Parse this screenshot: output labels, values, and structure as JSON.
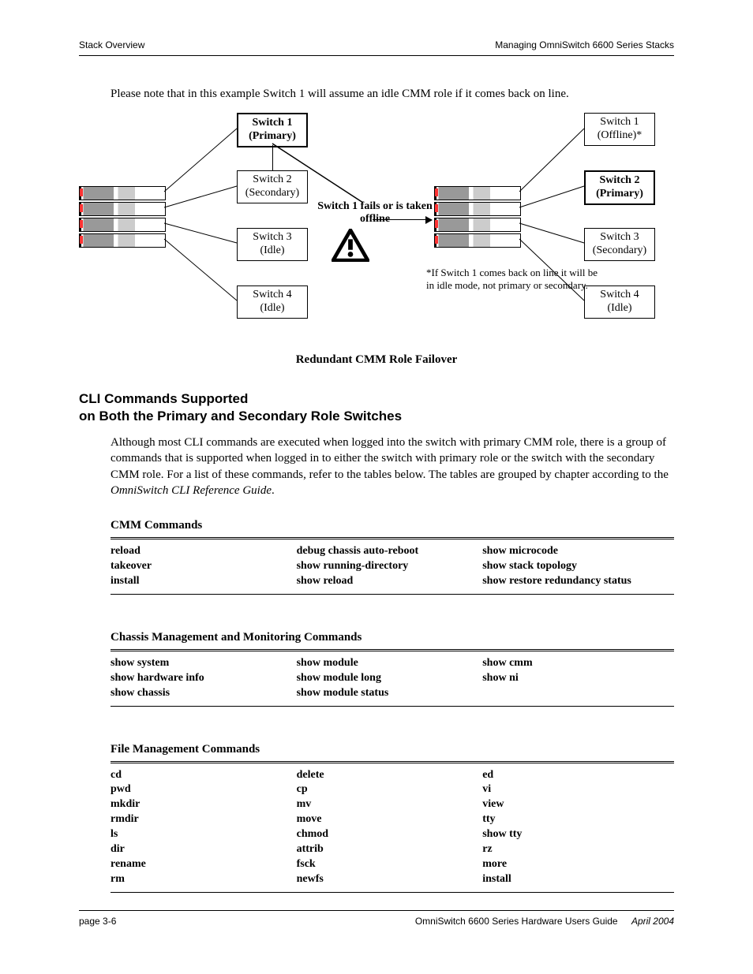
{
  "header": {
    "left": "Stack Overview",
    "right": "Managing OmniSwitch 6600 Series Stacks"
  },
  "intro": "Please note that in this example Switch 1 will assume an idle CMM role if it comes back on line.",
  "diagram": {
    "left": {
      "s1": {
        "l1": "Switch 1",
        "l2": "(Primary)"
      },
      "s2": {
        "l1": "Switch 2",
        "l2": "(Secondary)"
      },
      "s3": {
        "l1": "Switch 3",
        "l2": "(Idle)"
      },
      "s4": {
        "l1": "Switch 4",
        "l2": "(Idle)"
      }
    },
    "right": {
      "s1": {
        "l1": "Switch 1",
        "l2": "(Offline)*"
      },
      "s2": {
        "l1": "Switch 2",
        "l2": "(Primary)"
      },
      "s3": {
        "l1": "Switch 3",
        "l2": "(Secondary)"
      },
      "s4": {
        "l1": "Switch 4",
        "l2": "(Idle)"
      }
    },
    "center": "Switch 1 fails or is taken offline",
    "footnote": "*If Switch 1 comes back on line it will be in idle mode, not primary or secondary.",
    "caption": "Redundant CMM Role Failover"
  },
  "section_heading": {
    "l1": "CLI Commands Supported",
    "l2": "on Both the Primary and Secondary Role Switches"
  },
  "para": {
    "t1": "Although most CLI commands are executed when logged into the switch with primary CMM role, there is a group of commands that is supported when logged in to either the switch with primary role or the switch with the secondary CMM role. For a list of these commands, refer to the tables below. The tables are grouped by chapter according to the ",
    "em": "OmniSwitch CLI Reference Guide",
    "t2": "."
  },
  "tables": {
    "cmm": {
      "title": "CMM Commands",
      "c1": [
        "reload",
        "takeover",
        "install"
      ],
      "c2": [
        "debug chassis auto-reboot",
        "show running-directory",
        "show reload"
      ],
      "c3": [
        "show microcode",
        "show stack topology",
        "show restore redundancy status"
      ]
    },
    "chassis": {
      "title": "Chassis Management and Monitoring Commands",
      "c1": [
        "show system",
        "show hardware info",
        "show chassis"
      ],
      "c2": [
        "show module",
        "show module long",
        "show module status"
      ],
      "c3": [
        "show cmm",
        "show ni"
      ]
    },
    "file": {
      "title": "File Management Commands",
      "c1": [
        "cd",
        "pwd",
        "mkdir",
        "rmdir",
        "ls",
        "dir",
        "rename",
        "rm"
      ],
      "c2": [
        "delete",
        "cp",
        "mv",
        "move",
        "chmod",
        "attrib",
        "fsck",
        "newfs"
      ],
      "c3": [
        "ed",
        "vi",
        "view",
        "tty",
        "show tty",
        "rz",
        "more",
        "install"
      ]
    }
  },
  "footer": {
    "left": "page 3-6",
    "right": "OmniSwitch 6600 Series Hardware Users Guide",
    "date": "April 2004"
  }
}
